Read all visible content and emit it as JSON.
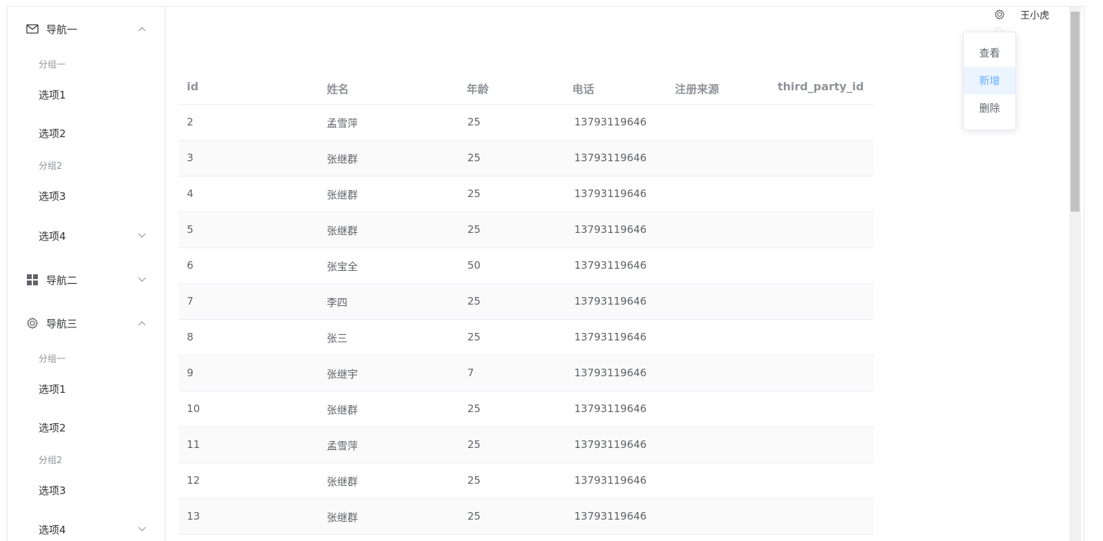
{
  "header": {
    "user_name": "王小虎",
    "gear_icon": "gear-icon"
  },
  "sidebar": {
    "nav1": {
      "title": "导航一",
      "groups": [
        {
          "title": "分组一",
          "items": [
            "选项1",
            "选项2"
          ]
        },
        {
          "title": "分组2",
          "items": [
            "选项3"
          ]
        }
      ],
      "submenu": "选项4"
    },
    "nav2": {
      "title": "导航二"
    },
    "nav3": {
      "title": "导航三",
      "groups": [
        {
          "title": "分组一",
          "items": [
            "选项1",
            "选项2"
          ]
        },
        {
          "title": "分组2",
          "items": [
            "选项3"
          ]
        }
      ],
      "submenu": "选项4"
    }
  },
  "dropdown": {
    "items": [
      "查看",
      "新增",
      "删除"
    ],
    "hover_index": 1
  },
  "table": {
    "columns": [
      "id",
      "姓名",
      "年龄",
      "电话",
      "注册来源",
      "third_party_id"
    ],
    "rows": [
      [
        "2",
        "孟雪萍",
        "25",
        "13793119646",
        "",
        ""
      ],
      [
        "3",
        "张继群",
        "25",
        "13793119646",
        "",
        ""
      ],
      [
        "4",
        "张继群",
        "25",
        "13793119646",
        "",
        ""
      ],
      [
        "5",
        "张继群",
        "25",
        "13793119646",
        "",
        ""
      ],
      [
        "6",
        "张宝全",
        "50",
        "13793119646",
        "",
        ""
      ],
      [
        "7",
        "李四",
        "25",
        "13793119646",
        "",
        ""
      ],
      [
        "8",
        "张三",
        "25",
        "13793119646",
        "",
        ""
      ],
      [
        "9",
        "张继宇",
        "7",
        "13793119646",
        "",
        ""
      ],
      [
        "10",
        "张继群",
        "25",
        "13793119646",
        "",
        ""
      ],
      [
        "11",
        "孟雪萍",
        "25",
        "13793119646",
        "",
        ""
      ],
      [
        "12",
        "张继群",
        "25",
        "13793119646",
        "",
        ""
      ],
      [
        "13",
        "张继群",
        "25",
        "13793119646",
        "",
        ""
      ]
    ]
  },
  "colors": {
    "accent": "#66b1ff",
    "hover_bg": "#ecf5ff",
    "border": "#ebeef5",
    "stripe": "#fafafa"
  }
}
